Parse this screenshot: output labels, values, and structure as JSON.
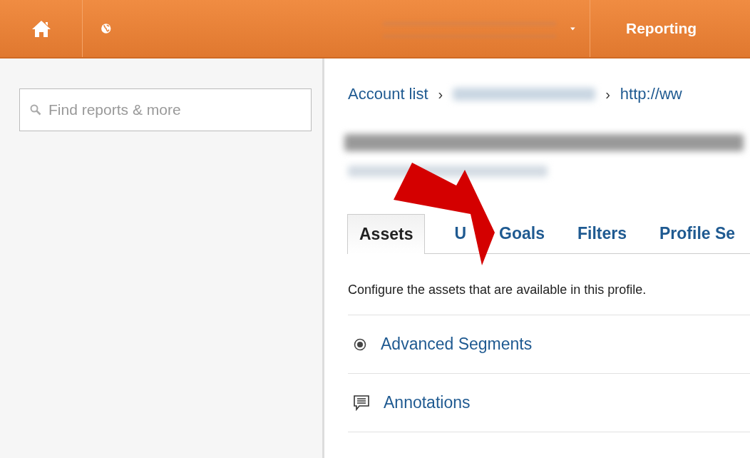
{
  "top_bar": {
    "reporting_label": "Reporting"
  },
  "sidebar": {
    "search": {
      "placeholder": "Find reports & more"
    }
  },
  "breadcrumb": [
    {
      "kind": "link",
      "text": "Account list"
    },
    {
      "kind": "separator",
      "text": "›"
    },
    {
      "kind": "redacted"
    },
    {
      "kind": "separator",
      "text": "›"
    },
    {
      "kind": "link",
      "text": "http://ww"
    }
  ],
  "tabs": [
    {
      "label": "Assets",
      "selected": true
    },
    {
      "label": "U",
      "selected": false
    },
    {
      "label": "Goals",
      "selected": false
    },
    {
      "label": "Filters",
      "selected": false
    },
    {
      "label": "Profile Se",
      "selected": false
    }
  ],
  "description": "Configure the assets that are available in this profile.",
  "assets": [
    {
      "kind": "segments",
      "label": "Advanced Segments"
    },
    {
      "kind": "annotations",
      "label": "Annotations"
    }
  ]
}
